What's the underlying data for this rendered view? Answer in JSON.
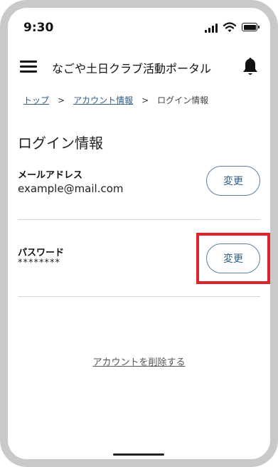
{
  "status_bar": {
    "time": "9:30"
  },
  "header": {
    "title": "なごや土日クラブ活動ポータル"
  },
  "breadcrumb": {
    "items": [
      "トップ",
      "アカウント情報",
      "ログイン情報"
    ],
    "separator": ">"
  },
  "page": {
    "title": "ログイン情報"
  },
  "email_section": {
    "label": "メールアドレス",
    "value": "example@mail.com",
    "button_label": "変更"
  },
  "password_section": {
    "label": "パスワード",
    "value": "********",
    "button_label": "変更"
  },
  "delete_account": {
    "label": "アカウントを削除する"
  },
  "colors": {
    "accent": "#2f5d86",
    "highlight": "#e0212a",
    "divider": "#d6d6d6"
  }
}
